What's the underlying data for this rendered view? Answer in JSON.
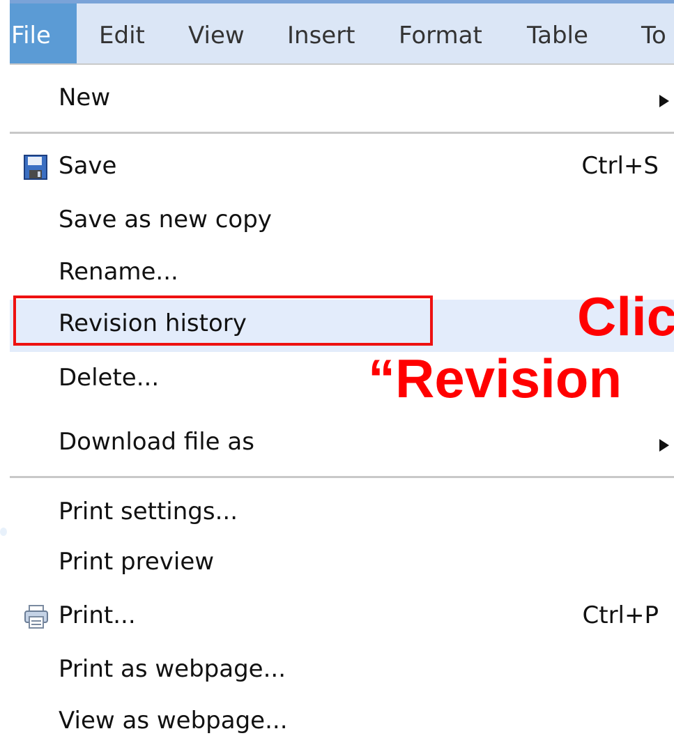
{
  "menubar": {
    "tabs": [
      {
        "label": "File",
        "active": true
      },
      {
        "label": "Edit"
      },
      {
        "label": "View"
      },
      {
        "label": "Insert"
      },
      {
        "label": "Format"
      },
      {
        "label": "Table"
      },
      {
        "label": "To"
      }
    ]
  },
  "file_menu": {
    "new": "New",
    "save": "Save",
    "save_shortcut": "Ctrl+S",
    "save_as_copy": "Save as new copy",
    "rename": "Rename...",
    "revision_history": "Revision history",
    "delete": "Delete...",
    "download_as": "Download file as",
    "print_settings": "Print settings...",
    "print_preview": "Print preview",
    "print": "Print...",
    "print_shortcut": "Ctrl+P",
    "print_as_webpage": "Print as webpage...",
    "view_as_webpage": "View as webpage..."
  },
  "callout": {
    "line1": "Clic",
    "line2": "“Revision"
  },
  "colors": {
    "menubar_bg": "#dbe6f6",
    "active_tab": "#5b9bd5",
    "highlight": "#e3ecfb",
    "callout_red": "#ff0000"
  },
  "icons": [
    "floppy-disk-icon",
    "printer-icon",
    "submenu-arrow-icon"
  ]
}
